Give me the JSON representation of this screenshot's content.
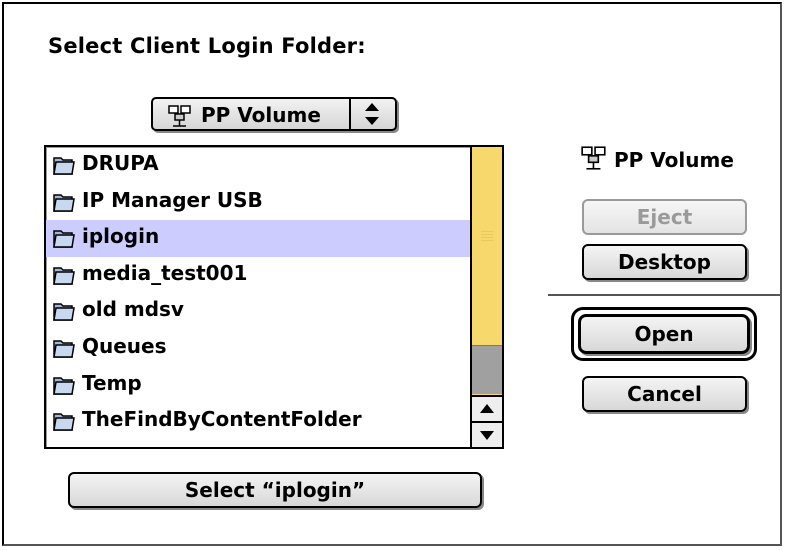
{
  "dialog": {
    "title": "Select Client Login Folder:",
    "volume_popup": {
      "selected": "PP Volume",
      "icon": "network-volume-icon"
    },
    "file_list": {
      "items": [
        {
          "label": "DRUPA",
          "icon": "folder-icon",
          "selected": false
        },
        {
          "label": "IP Manager USB",
          "icon": "folder-icon",
          "selected": false
        },
        {
          "label": "iplogin",
          "icon": "folder-icon",
          "selected": true
        },
        {
          "label": "media_test001",
          "icon": "folder-icon",
          "selected": false
        },
        {
          "label": "old mdsv",
          "icon": "folder-icon",
          "selected": false
        },
        {
          "label": "Queues",
          "icon": "folder-icon",
          "selected": false
        },
        {
          "label": "Temp",
          "icon": "folder-icon",
          "selected": false
        },
        {
          "label": "TheFindByContentFolder",
          "icon": "folder-icon",
          "selected": false
        }
      ],
      "selection_color": "#ccccff",
      "scrollbar_color": "#f6d86d"
    },
    "select_button": "Select “iplogin”",
    "sidebar": {
      "volume_label": "PP Volume",
      "eject_label": "Eject",
      "eject_enabled": false,
      "desktop_label": "Desktop",
      "open_label": "Open",
      "cancel_label": "Cancel"
    }
  }
}
